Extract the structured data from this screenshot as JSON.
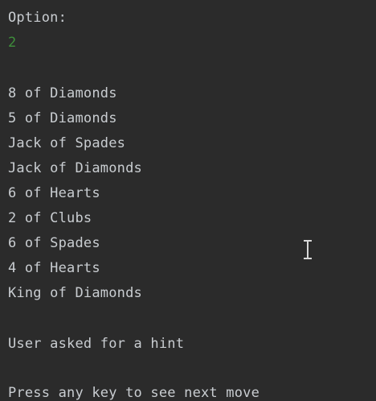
{
  "console": {
    "prompt_label": "Option:",
    "input_value": "2",
    "cards": [
      "8 of Diamonds",
      "5 of Diamonds",
      "Jack of Spades",
      "Jack of Diamonds",
      "6 of Hearts",
      "2 of Clubs",
      "6 of Spades",
      "4 of Hearts",
      "King of Diamonds"
    ],
    "hint_message": "User asked for a hint",
    "continue_message": "Press any key to see next move"
  },
  "icons": {
    "cursor": "text-cursor-ibeam-icon"
  },
  "colors": {
    "background": "#2b2b2b",
    "text": "#c9cdd1",
    "input_text": "#3f8f3b"
  }
}
